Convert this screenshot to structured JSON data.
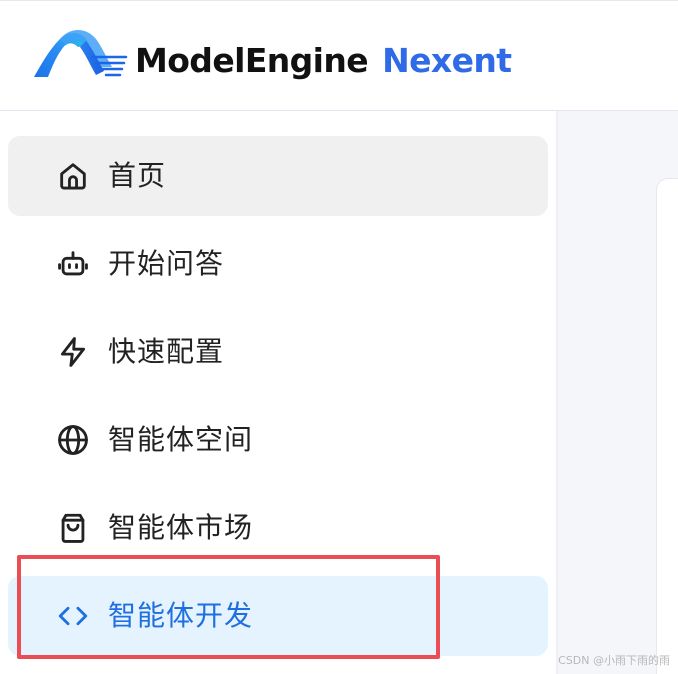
{
  "header": {
    "brand_primary": "ModelEngine",
    "brand_secondary": "Nexent",
    "logo_icon": "modelengine-logo-icon"
  },
  "sidebar": {
    "items": [
      {
        "label": "首页",
        "icon": "home-icon",
        "selected": false
      },
      {
        "label": "开始问答",
        "icon": "robot-icon",
        "selected": false
      },
      {
        "label": "快速配置",
        "icon": "lightning-icon",
        "selected": false
      },
      {
        "label": "智能体空间",
        "icon": "globe-icon",
        "selected": false
      },
      {
        "label": "智能体市场",
        "icon": "shopping-bag-icon",
        "selected": false
      },
      {
        "label": "智能体开发",
        "icon": "code-icon",
        "selected": true
      }
    ]
  },
  "colors": {
    "brand_blue": "#2f6be6",
    "active_text": "#1f6fe0",
    "active_bg": "#e4f3fe",
    "highlight": "#ea4d53"
  },
  "watermark": "CSDN @小雨下雨的雨"
}
